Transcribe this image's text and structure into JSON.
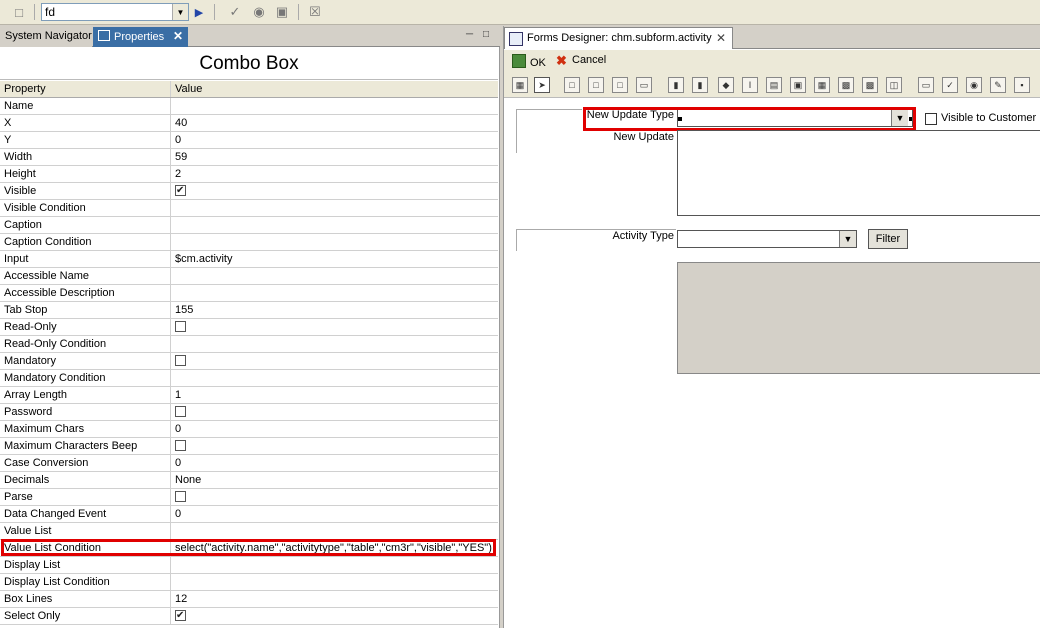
{
  "toolbar": {
    "search_value": "fd"
  },
  "left_panel": {
    "tabs": [
      {
        "label": "System Navigator"
      },
      {
        "label": "Properties"
      }
    ],
    "title": "Combo Box",
    "columns": [
      "Property",
      "Value"
    ],
    "rows": [
      {
        "name": "Name",
        "value": ""
      },
      {
        "name": "X",
        "value": "40"
      },
      {
        "name": "Y",
        "value": "0"
      },
      {
        "name": "Width",
        "value": "59"
      },
      {
        "name": "Height",
        "value": "2"
      },
      {
        "name": "Visible",
        "checkbox": true,
        "checked": true
      },
      {
        "name": "Visible Condition",
        "value": ""
      },
      {
        "name": "Caption",
        "value": ""
      },
      {
        "name": "Caption Condition",
        "value": ""
      },
      {
        "name": "Input",
        "value": "$cm.activity"
      },
      {
        "name": "Accessible Name",
        "value": ""
      },
      {
        "name": "Accessible Description",
        "value": ""
      },
      {
        "name": "Tab Stop",
        "value": "155"
      },
      {
        "name": "Read-Only",
        "checkbox": true,
        "checked": false
      },
      {
        "name": "Read-Only Condition",
        "value": ""
      },
      {
        "name": "Mandatory",
        "checkbox": true,
        "checked": false
      },
      {
        "name": "Mandatory Condition",
        "value": ""
      },
      {
        "name": "Array Length",
        "value": "1"
      },
      {
        "name": "Password",
        "checkbox": true,
        "checked": false
      },
      {
        "name": "Maximum Chars",
        "value": "0"
      },
      {
        "name": "Maximum Characters Beep",
        "checkbox": true,
        "checked": false
      },
      {
        "name": "Case Conversion",
        "value": "0"
      },
      {
        "name": "Decimals",
        "value": "None"
      },
      {
        "name": "Parse",
        "checkbox": true,
        "checked": false
      },
      {
        "name": "Data Changed Event",
        "value": "0"
      },
      {
        "name": "Value List",
        "value": ""
      },
      {
        "name": "Value List Condition",
        "value": "select(\"activity.name\",\"activitytype\",\"table\",\"cm3r\",\"visible\",\"YES\")",
        "highlighted": true
      },
      {
        "name": "Display List",
        "value": ""
      },
      {
        "name": "Display List Condition",
        "value": ""
      },
      {
        "name": "Box Lines",
        "value": "12"
      },
      {
        "name": "Select Only",
        "checkbox": true,
        "checked": true
      }
    ]
  },
  "right_panel": {
    "tab_label": "Forms Designer: chm.subform.activity",
    "ok_label": "OK",
    "cancel_label": "Cancel",
    "fields": {
      "new_update_type": "New Update Type",
      "visible_to_customer": "Visible to Customer",
      "new_update": "New Update",
      "activity_type": "Activity Type",
      "filter_button": "Filter"
    }
  },
  "colors": {
    "highlight": "#e00000",
    "active_tab": "#3a6ea5"
  }
}
